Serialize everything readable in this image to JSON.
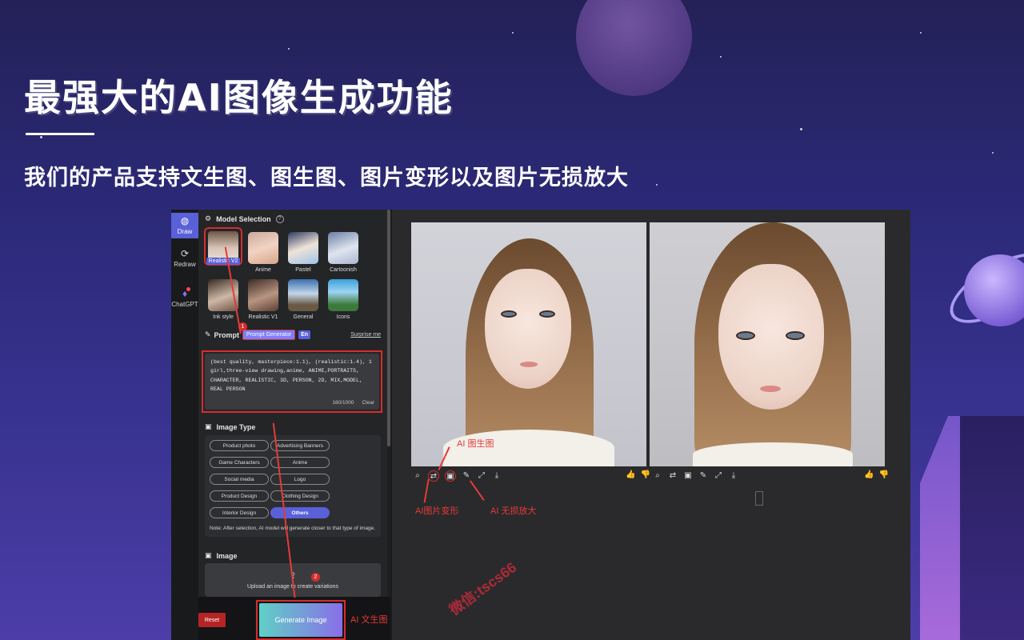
{
  "hero": {
    "title": "最强大的AI图像生成功能",
    "subtitle": "我们的产品支持文生图、图生图、图片变形以及图片无损放大"
  },
  "rail": {
    "items": [
      {
        "label": "Draw",
        "icon": "palette-icon"
      },
      {
        "label": "Redraw",
        "icon": "refresh-icon"
      },
      {
        "label": "ChatGPT",
        "icon": "chat-icon"
      }
    ]
  },
  "model_section": {
    "title": "Model Selection",
    "models": [
      {
        "label": "Realistic V2",
        "selected": true
      },
      {
        "label": "Anime"
      },
      {
        "label": "Pastel"
      },
      {
        "label": "Cartoonish"
      },
      {
        "label": "Ink style"
      },
      {
        "label": "Realistic V1"
      },
      {
        "label": "General"
      },
      {
        "label": "Icons"
      }
    ]
  },
  "prompt": {
    "title": "Prompt",
    "generator_label": "Prompt Generator",
    "lang_label": "En",
    "surprise_label": "Surprise me",
    "text": "(best quality, masterpiece:1.1), (realistic:1.4), 1 girl,three-view drawing,anime, ANIME,PORTRAITS, CHARACTER, REALISTIC, 3D, PERSON, 2D, MIX,MODEL, REAL PERSON",
    "count": "160/1000",
    "clear_label": "Clear",
    "step": "1"
  },
  "image_type": {
    "title": "Image Type",
    "options": [
      {
        "label": "Product photo"
      },
      {
        "label": "Advertising Banners"
      },
      {
        "label": "Game Characters"
      },
      {
        "label": "Anime"
      },
      {
        "label": "Social media"
      },
      {
        "label": "Logo"
      },
      {
        "label": "Product Design"
      },
      {
        "label": "Clothing Design"
      },
      {
        "label": "Interior Design"
      },
      {
        "label": "Others",
        "selected": true
      }
    ],
    "note": "Note: After selection, AI model will generate closer to that type of image."
  },
  "image_upload": {
    "title": "Image",
    "text": "Upload an image to create variations",
    "step": "2"
  },
  "actions": {
    "reset_label": "Reset",
    "generate_label": "Generate Image"
  },
  "annotations": {
    "img2img": "AI 图生图",
    "transform": "AI图片变形",
    "upscale": "AI 无损放大",
    "txt2img": "AI 文生图",
    "watermark": "微信:tscs66"
  },
  "colors": {
    "accent": "#5960d8",
    "highlight": "#d62d2d",
    "background": "#2c2a7a"
  }
}
